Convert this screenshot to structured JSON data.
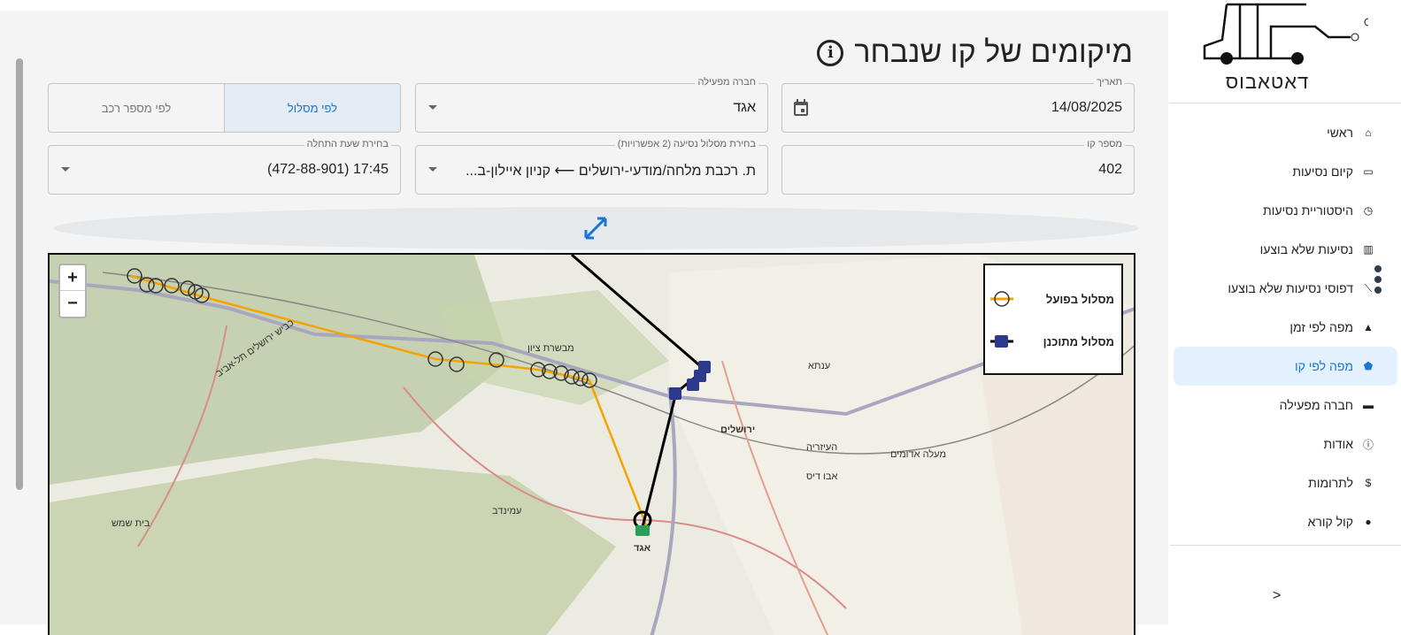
{
  "page": {
    "title": "מיקומים של קו שנבחר"
  },
  "filters": {
    "date": {
      "label": "תאריך",
      "value": "14/08/2025"
    },
    "operator": {
      "label": "חברה מפעילה",
      "value": "אגד"
    },
    "mode": {
      "by_route": "לפי מסלול",
      "by_vehicle": "לפי מספר רכב",
      "selected": "by_route"
    },
    "line": {
      "label": "מספר קו",
      "value": "402"
    },
    "route": {
      "label": "בחירת מסלול נסיעה (2 אפשרויות)",
      "value": "ת. רכבת מלחה/מודעי-ירושלים ⟵ קניון איילון-ב..."
    },
    "start_time": {
      "label": "בחירת שעת התחלה",
      "value": "17:45 (472-88-901)"
    }
  },
  "map": {
    "zoom_in": "+",
    "zoom_out": "−",
    "legend": {
      "actual": "מסלול בפועל",
      "planned": "מסלול מתוכנן"
    },
    "colors": {
      "actual": "#f5a300",
      "planned": "#000000"
    },
    "places": {
      "mevaseret": "מבשרת ציון",
      "jerusalem": "ירושלים",
      "beit_shemesh": "בית שמש",
      "egged": "אגד",
      "aminadav": "עמינדב",
      "eizariya": "העיזריה",
      "maale": "מעלה אדומים",
      "abu_dis": "אבו דיס",
      "anata": "ענתא",
      "highway": "כביש ירושלים תל-אביב"
    }
  },
  "sidebar": {
    "logo_text": "דאטאבוס",
    "items": [
      {
        "label": "ראשי",
        "icon": "home-icon"
      },
      {
        "label": "קיום נסיעות",
        "icon": "laptop-icon"
      },
      {
        "label": "היסטוריית נסיעות",
        "icon": "history-icon"
      },
      {
        "label": "נסיעות שלא בוצעו",
        "icon": "bar-chart-icon"
      },
      {
        "label": "דפוסי נסיעות שלא בוצעו",
        "icon": "line-chart-icon"
      },
      {
        "label": "מפה לפי זמן",
        "icon": "heatmap-icon"
      },
      {
        "label": "מפה לפי קו",
        "icon": "radar-icon",
        "active": true
      },
      {
        "label": "חברה מפעילה",
        "icon": "bus-icon"
      },
      {
        "label": "אודות",
        "icon": "info-icon"
      },
      {
        "label": "לתרומות",
        "icon": "dollar-icon"
      },
      {
        "label": "קול קורא",
        "icon": "bulb-icon"
      }
    ],
    "collapse": ">"
  }
}
